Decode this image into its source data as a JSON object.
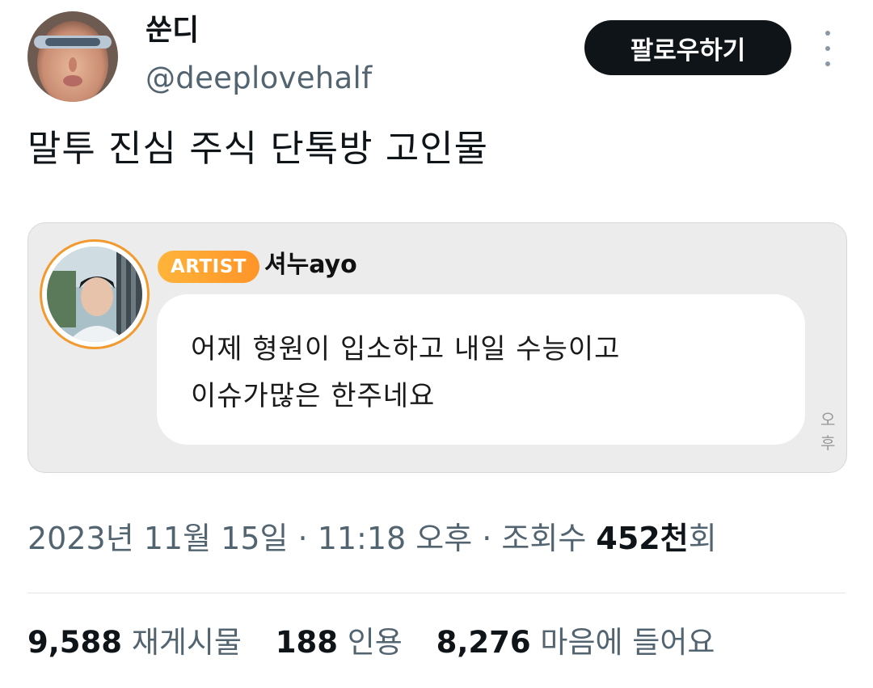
{
  "author": {
    "display_name": "쑨디",
    "handle": "@deeplovehalf",
    "avatar_icon": "profile-photo"
  },
  "follow_button_label": "팔로우하기",
  "more_icon": "more-vertical-icon",
  "tweet_text": "말투 진심 주식 단톡방 고인물",
  "media": {
    "badge": "ARTIST",
    "sender_name": "셔누ayo",
    "message_line_1": "어제 형원이 입소하고 내일 수능이고",
    "message_line_2": "이슈가많은 한주네요",
    "time_fragment": "오후",
    "badge_color": "#FF9F2E",
    "ring_color": "#F29A2E"
  },
  "meta": {
    "timestamp": "2023년 11월 15일 · 11:18 오후 · 조회수 ",
    "views_number": "452천",
    "views_suffix": "회"
  },
  "stats": {
    "retweets_count": "9,588",
    "retweets_label": "재게시물",
    "quotes_count": "188",
    "quotes_label": "인용",
    "likes_count": "8,276",
    "likes_label": "마음에 들어요"
  }
}
